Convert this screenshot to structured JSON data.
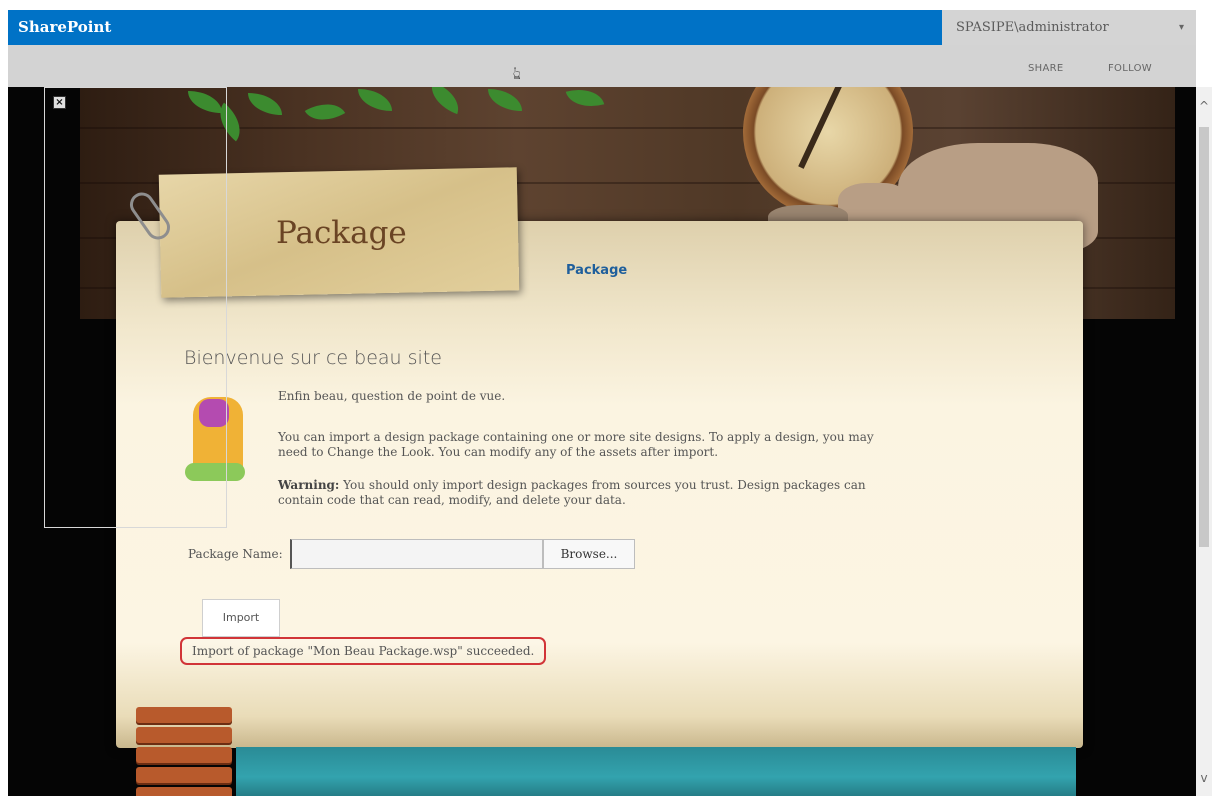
{
  "suitebar": {
    "brand": "SharePoint",
    "user": "SPASIPE\\administrator",
    "user_menu_glyph": "▾",
    "accent": "#0072c6"
  },
  "ribbon": {
    "share": "SHARE",
    "follow": "FOLLOW"
  },
  "site": {
    "title": "Package",
    "nav": [
      "Package"
    ]
  },
  "content": {
    "welcome": "Bienvenue sur ce beau site",
    "paragraph_1": "Enfin beau, question de point de vue.",
    "paragraph_2": "You can import a design package containing one or more site designs. To apply a design, you may need to Change the Look. You can modify any of the assets after import.",
    "warning_label": "Warning:",
    "warning_text": " You should only import design packages from sources you trust. Design packages can contain code that can read, modify, and delete your data."
  },
  "form": {
    "package_label": "Package Name:",
    "package_value": "",
    "browse_label": "Browse...",
    "import_label": "Import",
    "status": "Import of package \"Mon Beau Package.wsp\" succeeded.",
    "status_color": "#d13438"
  },
  "icons": {
    "close": "close-icon",
    "scroll_up": "chevron-up-icon",
    "scroll_down": "chevron-down-icon",
    "cursor": "mouse-pointer-icon"
  }
}
